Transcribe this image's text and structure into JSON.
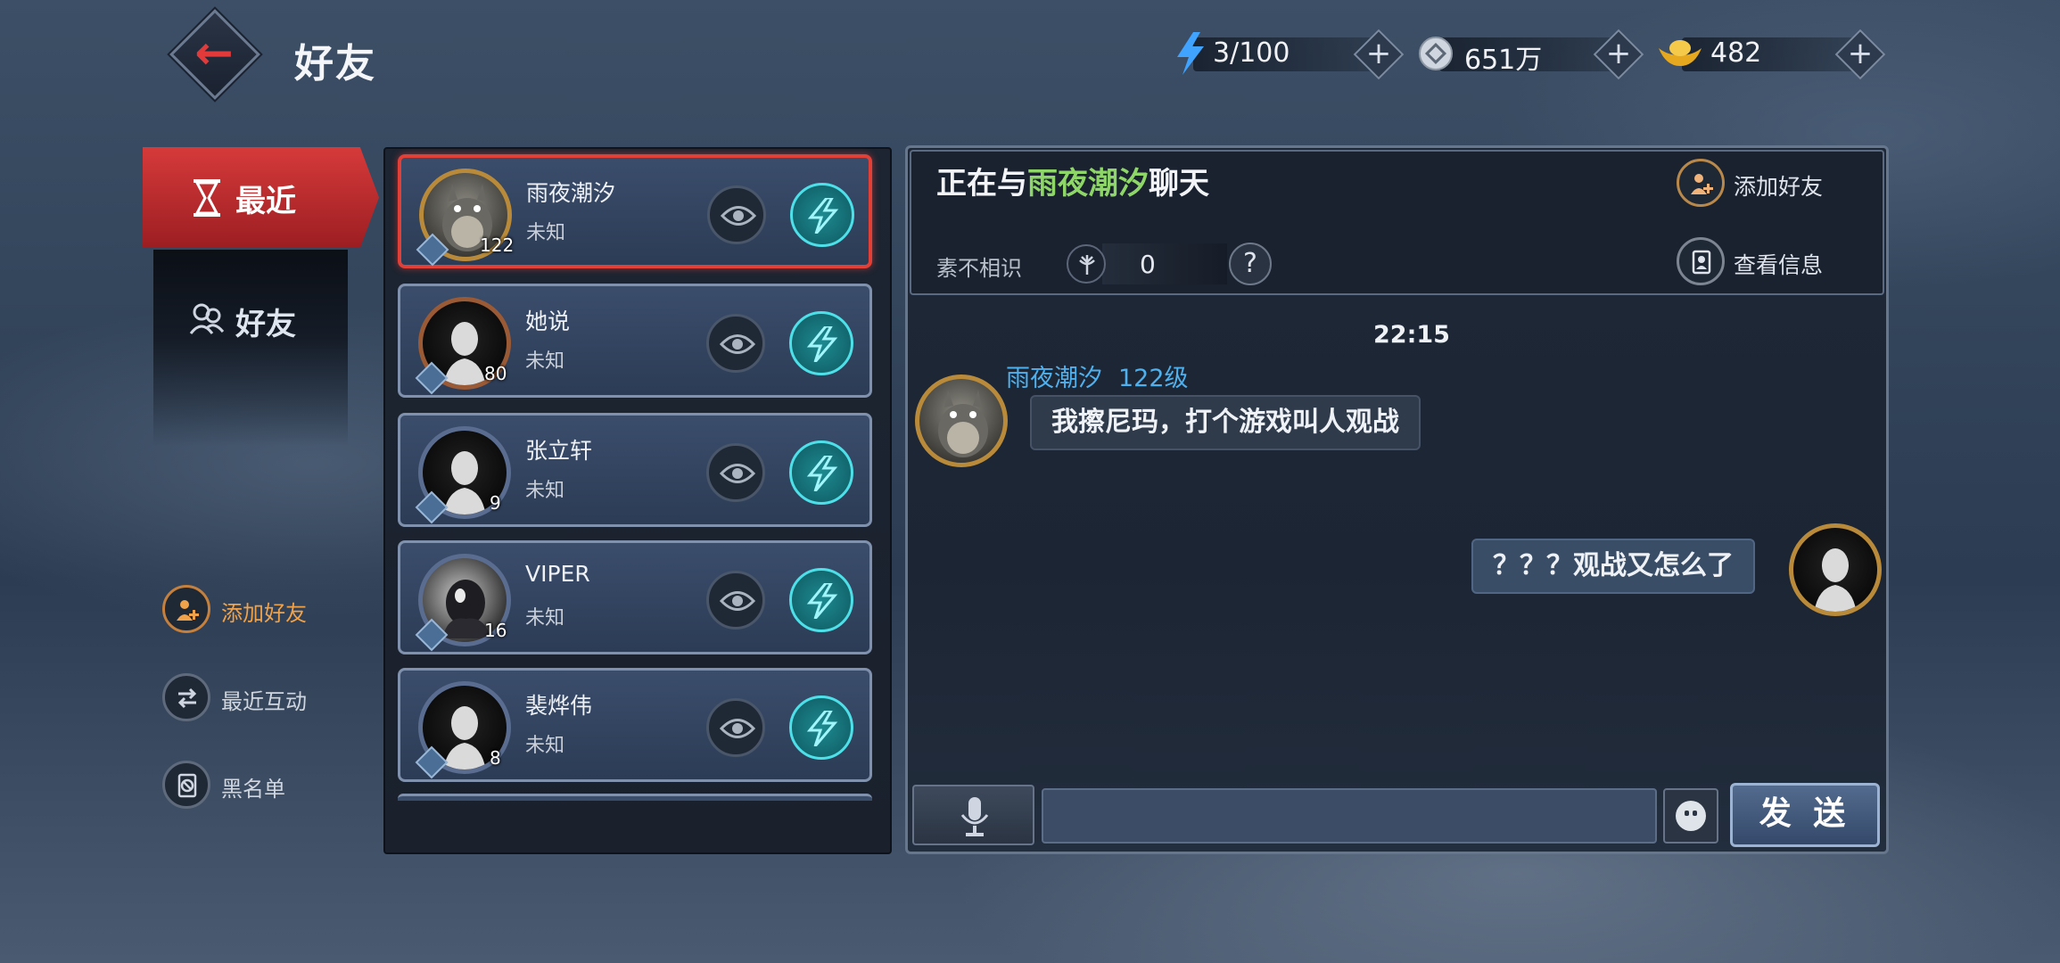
{
  "header": {
    "title": "好友",
    "resources": [
      {
        "icon": "lightning-icon",
        "value": "3/100"
      },
      {
        "icon": "coin-icon",
        "value": "651万"
      },
      {
        "icon": "gold-ingot-icon",
        "value": "482"
      }
    ],
    "plus_label": "+"
  },
  "nav": {
    "tabs": [
      {
        "label": "最近",
        "active": true
      },
      {
        "label": "好友",
        "active": false
      }
    ],
    "actions": [
      {
        "label": "添加好友"
      },
      {
        "label": "最近互动"
      },
      {
        "label": "黑名单"
      }
    ]
  },
  "friends": [
    {
      "name": "雨夜潮汐",
      "status": "未知",
      "level": "122",
      "selected": true
    },
    {
      "name": "她说",
      "status": "未知",
      "level": "80",
      "selected": false
    },
    {
      "name": "张立轩",
      "status": "未知",
      "level": "9",
      "selected": false
    },
    {
      "name": "VIPER",
      "status": "未知",
      "level": "16",
      "selected": false
    },
    {
      "name": "裴烨伟",
      "status": "未知",
      "level": "8",
      "selected": false
    }
  ],
  "chat": {
    "prefix": "正在与",
    "partner": "雨夜潮汐",
    "suffix": "聊天",
    "add_friend_label": "添加好友",
    "view_info_label": "查看信息",
    "relation_label": "素不相识",
    "relation_value": "0",
    "help_label": "?",
    "timestamp": "22:15",
    "messages": [
      {
        "direction": "in",
        "sender": "雨夜潮汐",
        "level": "122级",
        "text": "我擦尼玛，打个游戏叫人观战"
      },
      {
        "direction": "out",
        "text": "？？？观战又怎么了"
      }
    ],
    "input_value": "",
    "send_label": "发 送"
  },
  "colors": {
    "accent_red": "#d63a3a",
    "highlight_green": "#8fd668",
    "sender_blue": "#4fb0ee",
    "teal": "#4ee0e8"
  }
}
